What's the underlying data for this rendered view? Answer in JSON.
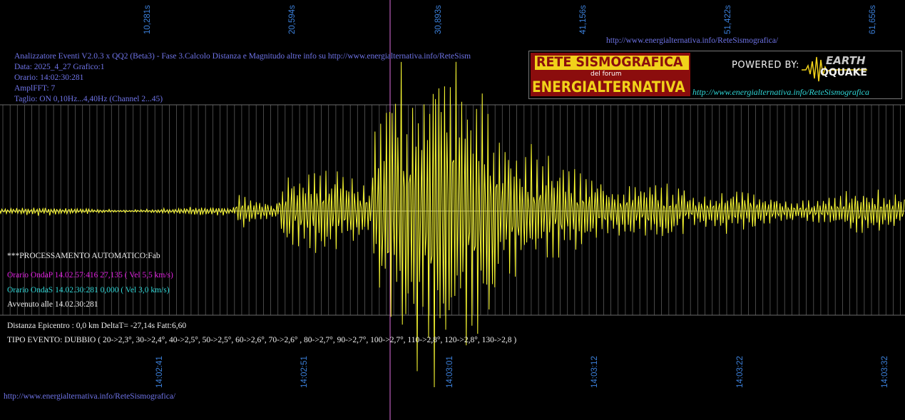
{
  "header": {
    "line1": "Analizzatore Eventi V2.0.3 x QQ2 (Beta3) - Fase 3.Calcolo Distanza e Magnitudo altre info su http://www.energialternativa.info/ReteSism",
    "line2": "Data: 2025_4_27 Grafico:1",
    "line3": "Orario: 14:02:30:281",
    "line4": "AmplFFT: 7",
    "line5": "Taglio: ON 0,10Hz...4,40Hz      (Channel 2...45)"
  },
  "top_url": "http://www.energialternativa.info/ReteSismografica/",
  "bottom_url": "http://www.energialternativa.info/ReteSismografica/",
  "logo": {
    "title": "RETE SISMOGRAFICA",
    "subtitle": "del forum",
    "name": "ENERGIALTERNATIVA",
    "powered": "POWERED BY:",
    "brand_top": "EARTH",
    "brand_bottom": "QQUAKE",
    "url": "http://www.energialternativa.info/ReteSismografica"
  },
  "processing": {
    "title": "***PROCESSAMENTO AUTOMATICO:Fab",
    "p_wave": "Orario OndaP 14.02.57:416  27,135 ( Vel 5,5 km/s)",
    "s_wave": "Orario OndaS 14.02.30:281  0,000 ( Vel 3,0 km/s)",
    "occurred": "Avvenuto alle 14.02.30:281",
    "distance": "Distanza Epicentro : 0,0 km DeltaT= -27,14s  Fatt:6,60",
    "event_type": "TIPO EVENTO: DUBBIO ( 20->2,3°, 30->2,4°, 40->2,5°, 50->2,5°, 60->2,6°, 70->2,6° , 80->2,7°, 90->2,7°, 100->2,7°, 110->2,8°, 120->2,8°, 130->2,8 )"
  },
  "seconds_ticks": [
    "10,281s",
    "20,594s",
    "30,893s",
    "41,156s",
    "51,422s",
    "61,656s"
  ],
  "time_ticks": [
    "14:02:41",
    "14:02:51",
    "14:03:01",
    "14:03:12",
    "14:03:22",
    "14:03:32"
  ],
  "colors": {
    "background": "#000000",
    "trace": "#ffff33",
    "grid": "#6a6a6a",
    "marker": "#e070e0",
    "axis_label": "#3b7fd9",
    "header_text": "#6f74e8",
    "p_wave": "#e020e0",
    "s_wave": "#30d8d8"
  }
}
